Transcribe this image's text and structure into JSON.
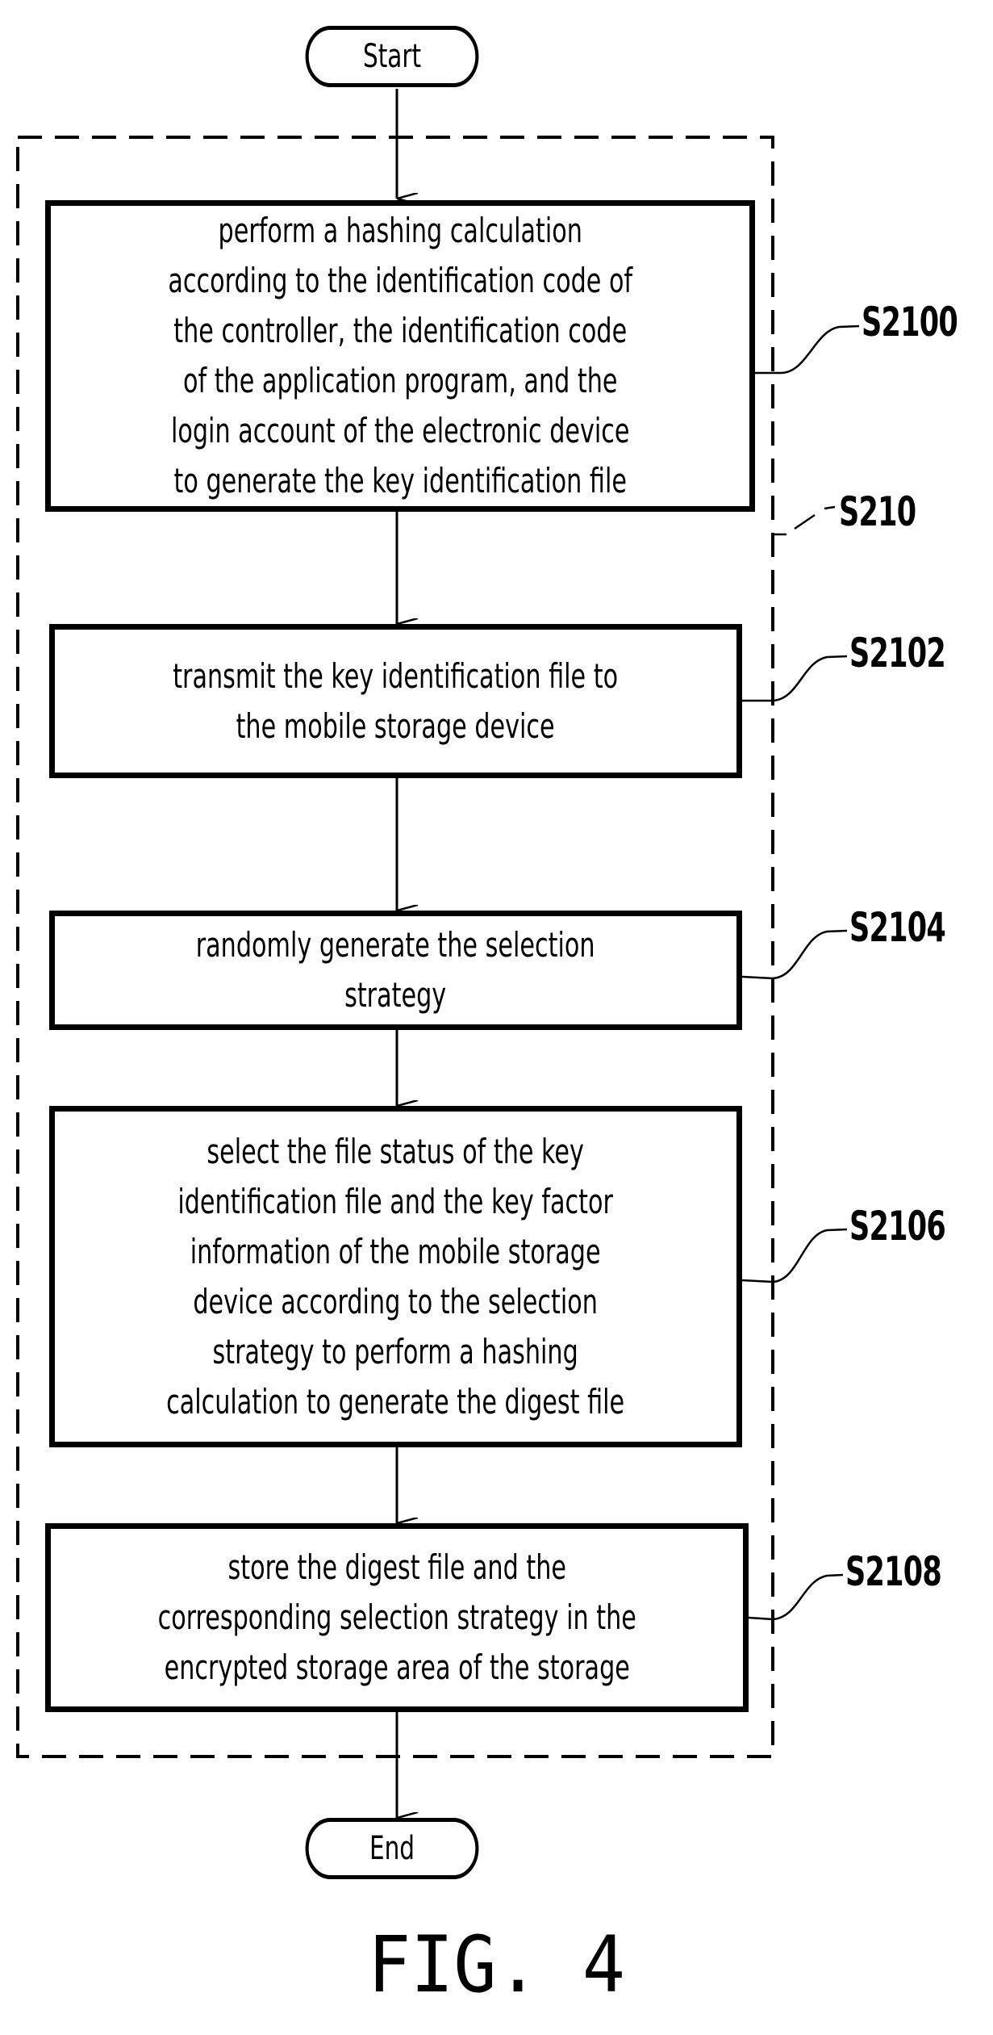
{
  "start": {
    "label": "Start"
  },
  "end": {
    "label": "End"
  },
  "group": {
    "ref": "S210"
  },
  "steps": [
    {
      "ref": "S2100",
      "text": "perform a hashing calculation\naccording to the identification code of\nthe controller, the identification code\nof the application program, and the\nlogin account of the electronic device\nto generate the key identification file"
    },
    {
      "ref": "S2102",
      "text": "transmit the key identification file to\nthe mobile storage device"
    },
    {
      "ref": "S2104",
      "text": "randomly generate the selection\nstrategy"
    },
    {
      "ref": "S2106",
      "text": "select the file status of the key\nidentification file and the key factor\ninformation of the mobile storage\ndevice according to the selection\nstrategy to perform a hashing\ncalculation to generate the digest file"
    },
    {
      "ref": "S2108",
      "text": "store the digest file and the\ncorresponding selection strategy in the\nencrypted storage area of the storage"
    }
  ],
  "caption": "FIG. 4"
}
